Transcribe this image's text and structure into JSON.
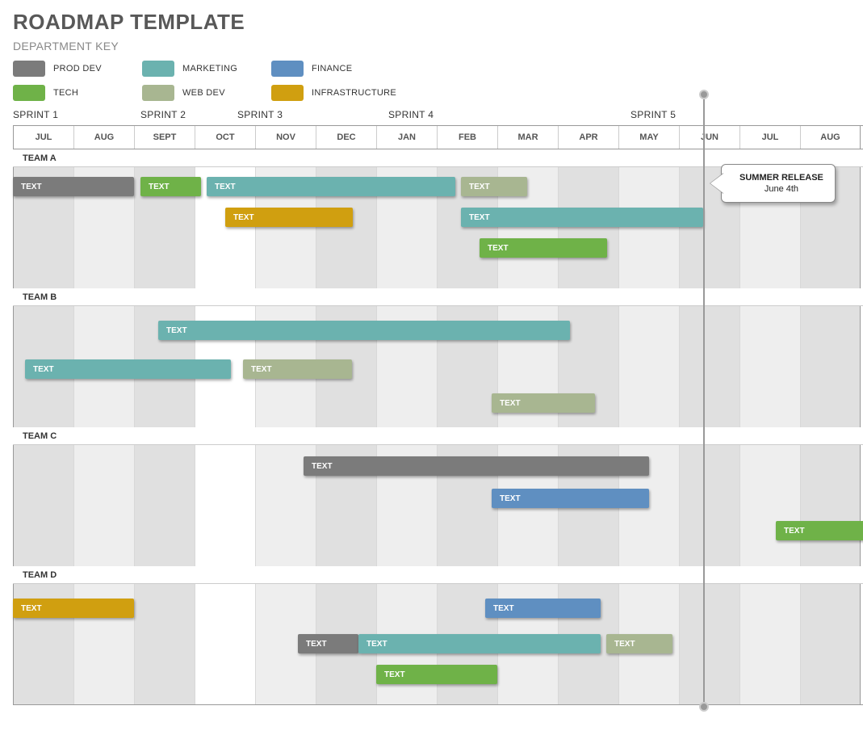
{
  "title": "ROADMAP TEMPLATE",
  "subtitle": "DEPARTMENT KEY",
  "legend": {
    "items": [
      {
        "label": "PROD DEV",
        "color": "#7b7b7b"
      },
      {
        "label": "MARKETING",
        "color": "#6bb2af"
      },
      {
        "label": "FINANCE",
        "color": "#5f8fc1"
      },
      {
        "label": "TECH",
        "color": "#6fb248"
      },
      {
        "label": "WEB DEV",
        "color": "#a8b691"
      },
      {
        "label": "INFRASTRUCTURE",
        "color": "#d09f10"
      }
    ]
  },
  "sprints": [
    "SPRINT 1",
    "SPRINT 2",
    "SPRINT 3",
    "SPRINT 4",
    "SPRINT 5"
  ],
  "months": [
    "JUL",
    "AUG",
    "SEPT",
    "OCT",
    "NOV",
    "DEC",
    "JAN",
    "FEB",
    "MAR",
    "APR",
    "MAY",
    "JUN",
    "JUL",
    "AUG"
  ],
  "teams": {
    "a": {
      "label": "TEAM A"
    },
    "b": {
      "label": "TEAM B"
    },
    "c": {
      "label": "TEAM C"
    },
    "d": {
      "label": "TEAM D"
    }
  },
  "task_label": "TEXT",
  "callout": {
    "title": "SUMMER RELEASE",
    "sub": "June 4th"
  },
  "chart_data": {
    "type": "gantt",
    "xaxis": {
      "unit": "month",
      "categories": [
        "JUL",
        "AUG",
        "SEPT",
        "OCT",
        "NOV",
        "DEC",
        "JAN",
        "FEB",
        "MAR",
        "APR",
        "MAY",
        "JUN",
        "JUL",
        "AUG"
      ]
    },
    "sprints": [
      {
        "name": "SPRINT 1",
        "start": 0.0
      },
      {
        "name": "SPRINT 2",
        "start": 2.1
      },
      {
        "name": "SPRINT 3",
        "start": 3.7
      },
      {
        "name": "SPRINT 4",
        "start": 6.2
      },
      {
        "name": "SPRINT 5",
        "start": 10.2
      }
    ],
    "marker": {
      "label": "SUMMER RELEASE",
      "date": "June 4th",
      "position": 11.4
    },
    "teams": [
      {
        "name": "TEAM A",
        "tasks": [
          {
            "label": "TEXT",
            "dept": "PROD DEV",
            "start": 0.0,
            "end": 2.0,
            "row": 0
          },
          {
            "label": "TEXT",
            "dept": "TECH",
            "start": 2.1,
            "end": 3.1,
            "row": 0
          },
          {
            "label": "TEXT",
            "dept": "MARKETING",
            "start": 3.2,
            "end": 7.3,
            "row": 0
          },
          {
            "label": "TEXT",
            "dept": "WEB DEV",
            "start": 7.4,
            "end": 8.5,
            "row": 0
          },
          {
            "label": "TEXT",
            "dept": "INFRASTRUCTURE",
            "start": 3.5,
            "end": 5.6,
            "row": 1
          },
          {
            "label": "TEXT",
            "dept": "MARKETING",
            "start": 7.4,
            "end": 11.4,
            "row": 1
          },
          {
            "label": "TEXT",
            "dept": "TECH",
            "start": 7.7,
            "end": 9.8,
            "row": 2
          }
        ]
      },
      {
        "name": "TEAM B",
        "tasks": [
          {
            "label": "TEXT",
            "dept": "MARKETING",
            "start": 2.4,
            "end": 9.2,
            "row": 0
          },
          {
            "label": "TEXT",
            "dept": "MARKETING",
            "start": 0.2,
            "end": 3.6,
            "row": 1
          },
          {
            "label": "TEXT",
            "dept": "WEB DEV",
            "start": 3.8,
            "end": 5.6,
            "row": 1
          },
          {
            "label": "TEXT",
            "dept": "WEB DEV",
            "start": 7.9,
            "end": 9.6,
            "row": 2
          }
        ]
      },
      {
        "name": "TEAM C",
        "tasks": [
          {
            "label": "TEXT",
            "dept": "PROD DEV",
            "start": 4.8,
            "end": 10.5,
            "row": 0
          },
          {
            "label": "TEXT",
            "dept": "FINANCE",
            "start": 7.9,
            "end": 10.5,
            "row": 1
          },
          {
            "label": "TEXT",
            "dept": "TECH",
            "start": 12.6,
            "end": 14.2,
            "row": 2
          }
        ]
      },
      {
        "name": "TEAM D",
        "tasks": [
          {
            "label": "TEXT",
            "dept": "INFRASTRUCTURE",
            "start": 0.0,
            "end": 2.0,
            "row": 0
          },
          {
            "label": "TEXT",
            "dept": "FINANCE",
            "start": 7.8,
            "end": 9.7,
            "row": 0
          },
          {
            "label": "TEXT",
            "dept": "PROD DEV",
            "start": 4.7,
            "end": 5.7,
            "row": 1
          },
          {
            "label": "TEXT",
            "dept": "MARKETING",
            "start": 5.7,
            "end": 9.7,
            "row": 1
          },
          {
            "label": "TEXT",
            "dept": "WEB DEV",
            "start": 9.8,
            "end": 10.9,
            "row": 1
          },
          {
            "label": "TEXT",
            "dept": "TECH",
            "start": 6.0,
            "end": 8.0,
            "row": 2
          }
        ]
      }
    ]
  }
}
